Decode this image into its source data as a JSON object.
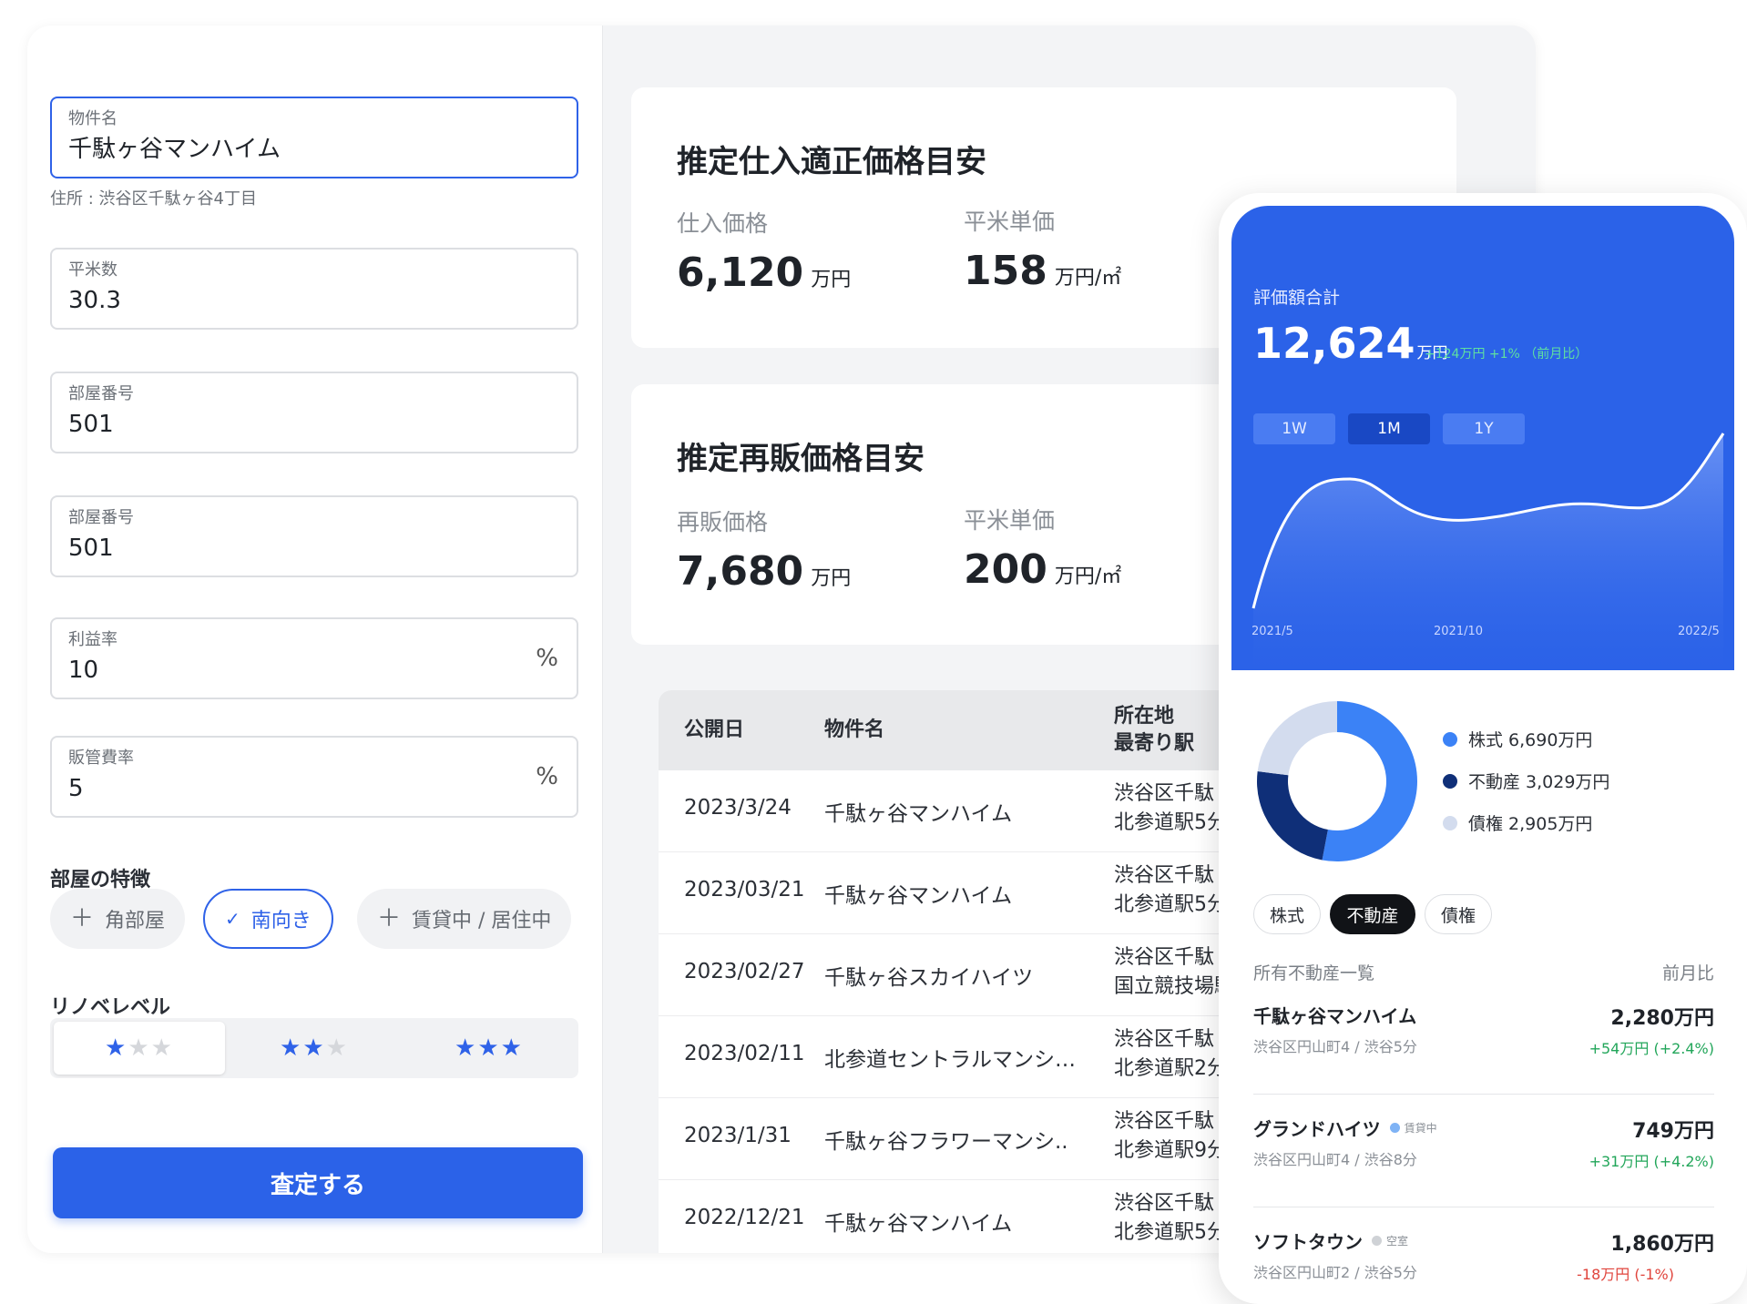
{
  "form": {
    "property_name": {
      "label": "物件名",
      "value": "千駄ヶ谷マンハイム"
    },
    "address": "住所 : 渋谷区千駄ヶ谷4丁目",
    "area": {
      "label": "平米数",
      "value": "30.3"
    },
    "room_no_1": {
      "label": "部屋番号",
      "value": "501"
    },
    "room_no_2": {
      "label": "部屋番号",
      "value": "501"
    },
    "profit_rate": {
      "label": "利益率",
      "value": "10",
      "unit": "%"
    },
    "sga_rate": {
      "label": "販管費率",
      "value": "5",
      "unit": "%"
    },
    "features_label": "部屋の特徴",
    "features": [
      {
        "label": "角部屋",
        "icon": "plus-icon",
        "selected": false
      },
      {
        "label": "南向き",
        "icon": "check-icon",
        "selected": true
      },
      {
        "label": "賃貸中 / 居住中",
        "icon": "plus-icon",
        "selected": false
      }
    ],
    "reno_label": "リノベレベル",
    "reno_selected": 1,
    "submit_label": "査定する"
  },
  "purchase": {
    "title": "推定仕入適正価格目安",
    "price_label": "仕入価格",
    "price_value": "6,120",
    "price_unit": "万円",
    "unit_label": "平米単価",
    "unit_value": "158",
    "unit_unit": "万円/㎡"
  },
  "resale": {
    "title": "推定再販価格目安",
    "price_label": "再販価格",
    "price_value": "7,680",
    "price_unit": "万円",
    "unit_label": "平米単価",
    "unit_value": "200",
    "unit_unit": "万円/㎡"
  },
  "table": {
    "headers": {
      "date": "公開日",
      "name": "物件名",
      "loc1": "所在地",
      "loc2": "最寄り駅"
    },
    "rows": [
      {
        "date": "2023/3/24",
        "name": "千駄ヶ谷マンハイム",
        "loc1": "渋谷区千駄",
        "loc2": "北参道駅5分"
      },
      {
        "date": "2023/03/21",
        "name": "千駄ヶ谷マンハイム",
        "loc1": "渋谷区千駄",
        "loc2": "北参道駅5分"
      },
      {
        "date": "2023/02/27",
        "name": "千駄ヶ谷スカイハイツ",
        "loc1": "渋谷区千駄",
        "loc2": "国立競技場駅"
      },
      {
        "date": "2023/02/11",
        "name": "北参道セントラルマンシ…",
        "loc1": "渋谷区千駄",
        "loc2": "北参道駅2分"
      },
      {
        "date": "2023/1/31",
        "name": "千駄ヶ谷フラワーマンシ..",
        "loc1": "渋谷区千駄",
        "loc2": "北参道駅9分"
      },
      {
        "date": "2022/12/21",
        "name": "千駄ヶ谷マンハイム",
        "loc1": "渋谷区千駄",
        "loc2": "北参道駅5分"
      }
    ]
  },
  "mobile": {
    "total_label": "評価額合計",
    "total_value": "12,624",
    "total_unit": "万円",
    "change": "+124万円  +1% （前月比）",
    "ranges": [
      "1W",
      "1M",
      "1Y"
    ],
    "active_range": "1M",
    "chart_x_labels": [
      "2021/5",
      "2021/10",
      "2022/5"
    ],
    "colors": {
      "hero": "#2b62e8",
      "stocks": "#3b82f6",
      "real_estate": "#0f2f78",
      "bonds": "#d3dcee"
    },
    "legend": [
      {
        "label": "株式 6,690万円",
        "value": 6690,
        "color": "#3b82f6"
      },
      {
        "label": "不動産 3,029万円",
        "value": 3029,
        "color": "#0f2f78"
      },
      {
        "label": "債権 2,905万円",
        "value": 2905,
        "color": "#d3dcee"
      }
    ],
    "tabs": [
      "株式",
      "不動産",
      "債権"
    ],
    "active_tab": "不動産",
    "list_title": "所有不動産一覧",
    "list_right": "前月比",
    "properties": [
      {
        "name": "千駄ヶ谷マンハイム",
        "badge": "",
        "badge_color": "",
        "addr": "渋谷区円山町4 / 渋谷5分",
        "value": "2,280万円",
        "delta": "+54万円 (+2.4%)",
        "trend": "up"
      },
      {
        "name": "グランドハイツ",
        "badge": "賃貸中",
        "badge_color": "#7fb3f5",
        "addr": "渋谷区円山町4 / 渋谷8分",
        "value": "749万円",
        "delta": "+31万円 (+4.2%)",
        "trend": "up"
      },
      {
        "name": "ソフトタウン",
        "badge": "空室",
        "badge_color": "#cfd2d6",
        "addr": "渋谷区円山町2 / 渋谷5分",
        "value": "1,860万円",
        "delta": "-18万円 (-1%)",
        "trend": "down"
      }
    ]
  }
}
